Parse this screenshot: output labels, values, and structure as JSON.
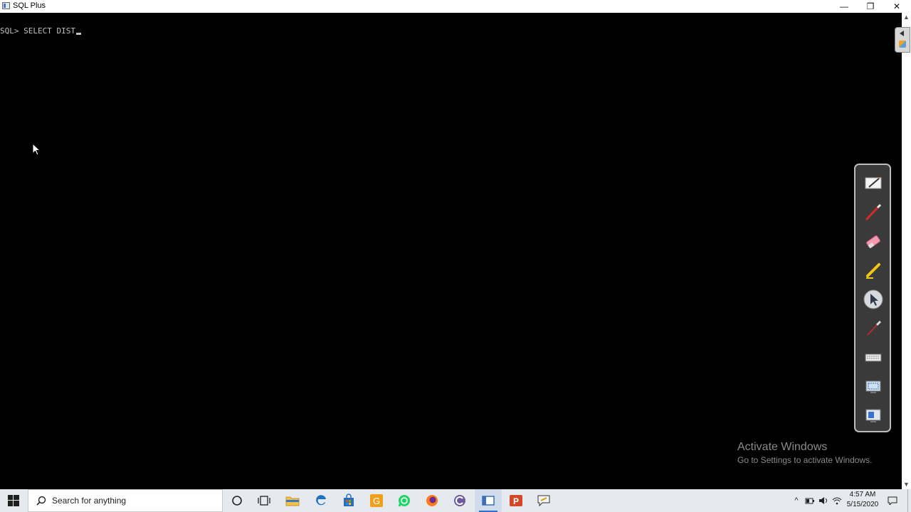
{
  "window": {
    "title": "SQL Plus",
    "minimize_glyph": "—",
    "restore_glyph": "❐",
    "close_glyph": "✕"
  },
  "console": {
    "prompt": "SQL>",
    "command": "SELECT DIST"
  },
  "scrollbar": {
    "up_glyph": "▲",
    "down_glyph": "▼"
  },
  "pen_toolbar": {
    "tools": [
      "notebook-icon",
      "red-pen-icon",
      "eraser-icon",
      "highlighter-icon",
      "pointer-icon",
      "brush-icon",
      "keyboard-icon",
      "screen-capture-icon",
      "screen-mode-icon"
    ]
  },
  "watermark": {
    "title": "Activate Windows",
    "subtitle": "Go to Settings to activate Windows."
  },
  "taskbar": {
    "search_placeholder": "Search for anything",
    "apps": [
      "cortana-icon",
      "task-view-icon",
      "file-explorer-icon",
      "edge-icon",
      "store-icon",
      "orange-app-icon",
      "whatsapp-icon",
      "firefox-icon",
      "browser-icon",
      "sqlplus-taskbar-icon",
      "powerpoint-icon",
      "chat-app-icon"
    ],
    "tray": {
      "chevron": "^",
      "time": "4:57 AM",
      "date": "5/15/2020"
    }
  },
  "colors": {
    "console_bg": "#000000",
    "console_text": "#c0c0c0",
    "taskbar_bg": "#e6e9ee",
    "accent": "#2b72c8"
  }
}
